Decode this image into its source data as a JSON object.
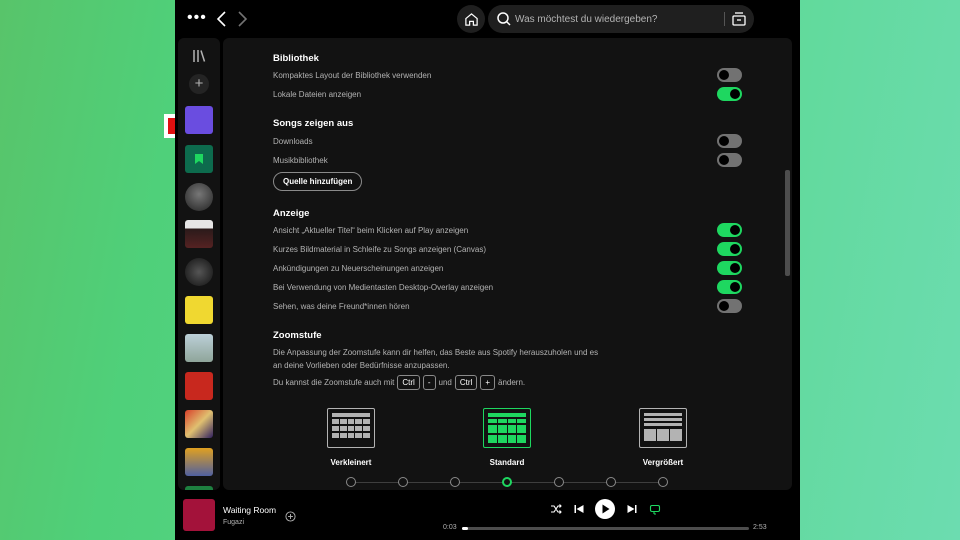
{
  "colors": {
    "accent": "#1ed760",
    "arrow": "#e01010",
    "now_playing_cover": "#a3123a"
  },
  "topbar": {
    "menu_icon": "more-dots-icon",
    "back_icon": "chevron-left-icon",
    "forward_icon": "chevron-right-icon",
    "home_icon": "home-icon",
    "search_placeholder": "Was möchtest du wiedergeben?",
    "browse_icon": "browse-icon"
  },
  "settings": {
    "library": {
      "title": "Bibliothek",
      "items": [
        {
          "label": "Kompaktes Layout der Bibliothek verwenden",
          "on": false
        },
        {
          "label": "Lokale Dateien anzeigen",
          "on": true
        }
      ]
    },
    "songs": {
      "title": "Songs zeigen aus",
      "items": [
        {
          "label": "Downloads",
          "on": false
        },
        {
          "label": "Musikbibliothek",
          "on": false
        }
      ],
      "add_source_label": "Quelle hinzufügen"
    },
    "display": {
      "title": "Anzeige",
      "items": [
        {
          "label": "Ansicht „Aktueller Titel“ beim Klicken auf Play anzeigen",
          "on": true
        },
        {
          "label": "Kurzes Bildmaterial in Schleife zu Songs anzeigen (Canvas)",
          "on": true
        },
        {
          "label": "Ankündigungen zu Neuerscheinungen anzeigen",
          "on": true
        },
        {
          "label": "Bei Verwendung von Medientasten Desktop-Overlay anzeigen",
          "on": true
        },
        {
          "label": "Sehen, was deine Freund*innen hören",
          "on": false
        }
      ]
    },
    "zoom": {
      "title": "Zoomstufe",
      "description": "Die Anpassung der Zoomstufe kann dir helfen, das Beste aus Spotify herauszuholen und es an deine Vorlieben oder Bedürfnisse anzupassen.",
      "shortcut_prefix": "Du kannst die Zoomstufe auch mit",
      "key_ctrl": "Ctrl",
      "key_minus": "-",
      "shortcut_and": "und",
      "key_plus": "+",
      "shortcut_suffix": "ändern.",
      "options": [
        {
          "label": "Verkleinert"
        },
        {
          "label": "Standard",
          "active": true
        },
        {
          "label": "Vergrößert"
        }
      ],
      "levels": 7,
      "selected_level": 4
    }
  },
  "player": {
    "title": "Waiting Room",
    "artist": "Fugazi",
    "time_current": "0:03",
    "time_total": "2:53",
    "progress": 0.02
  }
}
